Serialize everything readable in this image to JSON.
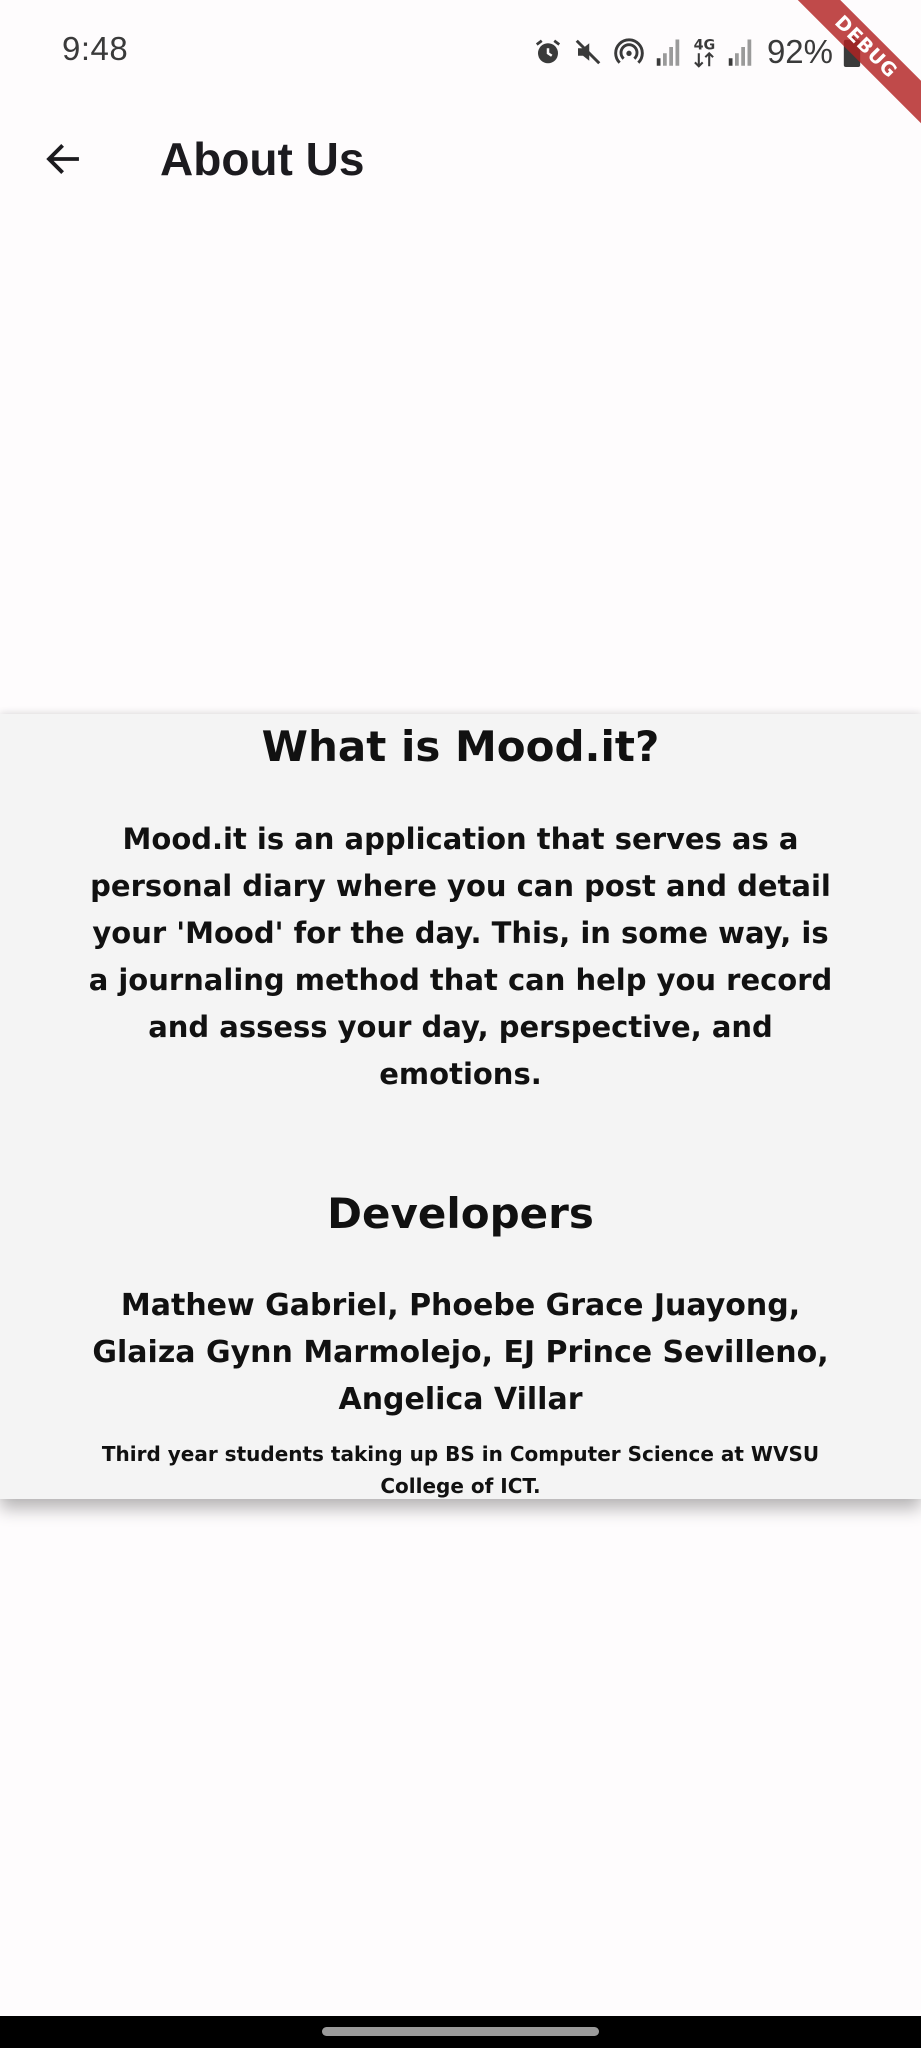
{
  "status_bar": {
    "time": "9:48",
    "battery": "92%",
    "icons": [
      "alarm-icon",
      "mute-icon",
      "hotspot-icon",
      "signal-icon",
      "4g-icon",
      "signal-icon",
      "battery-icon"
    ]
  },
  "debug_banner": "DEBUG",
  "app_bar": {
    "title": "About Us",
    "back_icon": "arrow-back-icon"
  },
  "about": {
    "heading": "What is Mood.it?",
    "description": "Mood.it is an application that serves as a personal diary where you can post and detail your 'Mood' for the day. This, in some way, is a journaling method that can help you record and assess your day, perspective, and emotions."
  },
  "developers": {
    "heading": "Developers",
    "names": "Mathew Gabriel, Phoebe Grace Juayong, Glaiza Gynn Marmolejo, EJ Prince Sevilleno, Angelica Villar",
    "note": "Third year students taking up BS in Computer Science at WVSU College of ICT."
  },
  "colors": {
    "background": "#fefcfd",
    "card": "#f4f4f4",
    "text": "#111111",
    "debug_ribbon": "#b22222"
  }
}
